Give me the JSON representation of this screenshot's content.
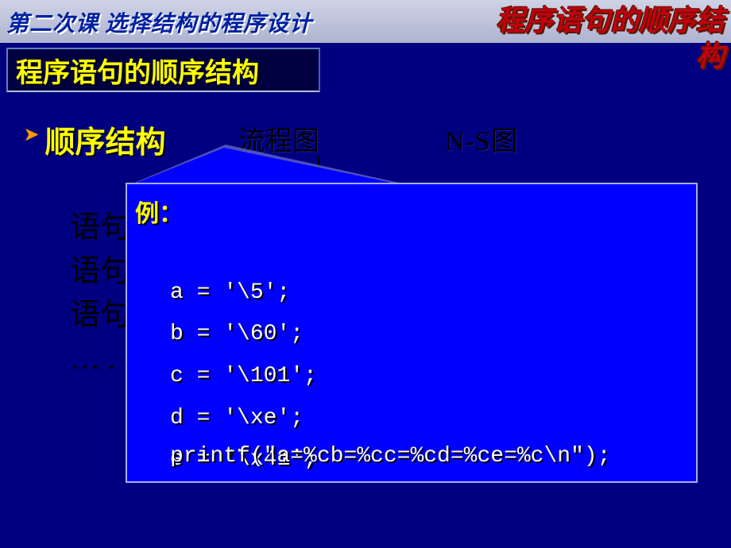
{
  "header": {
    "lesson_title": "第二次课 选择结构的程序设计",
    "red_heading_line1": "程序语句的顺序结",
    "red_heading_line2": "构"
  },
  "subheader": "程序语句的顺序结构",
  "bullet": "顺序结构",
  "columns": {
    "flowchart": "流程图",
    "ns": "N-S图"
  },
  "left_lines": [
    "语句",
    "语句",
    "语句",
    "… ."
  ],
  "code": {
    "label": "例：",
    "lines": [
      "a = '\\5';",
      "b = '\\60';",
      "c = '\\101';",
      "d = '\\xe';",
      "e = '\\x41';"
    ],
    "last": "printf(\"a=%cb=%cc=%cd=%ce=%c\\n\");"
  }
}
